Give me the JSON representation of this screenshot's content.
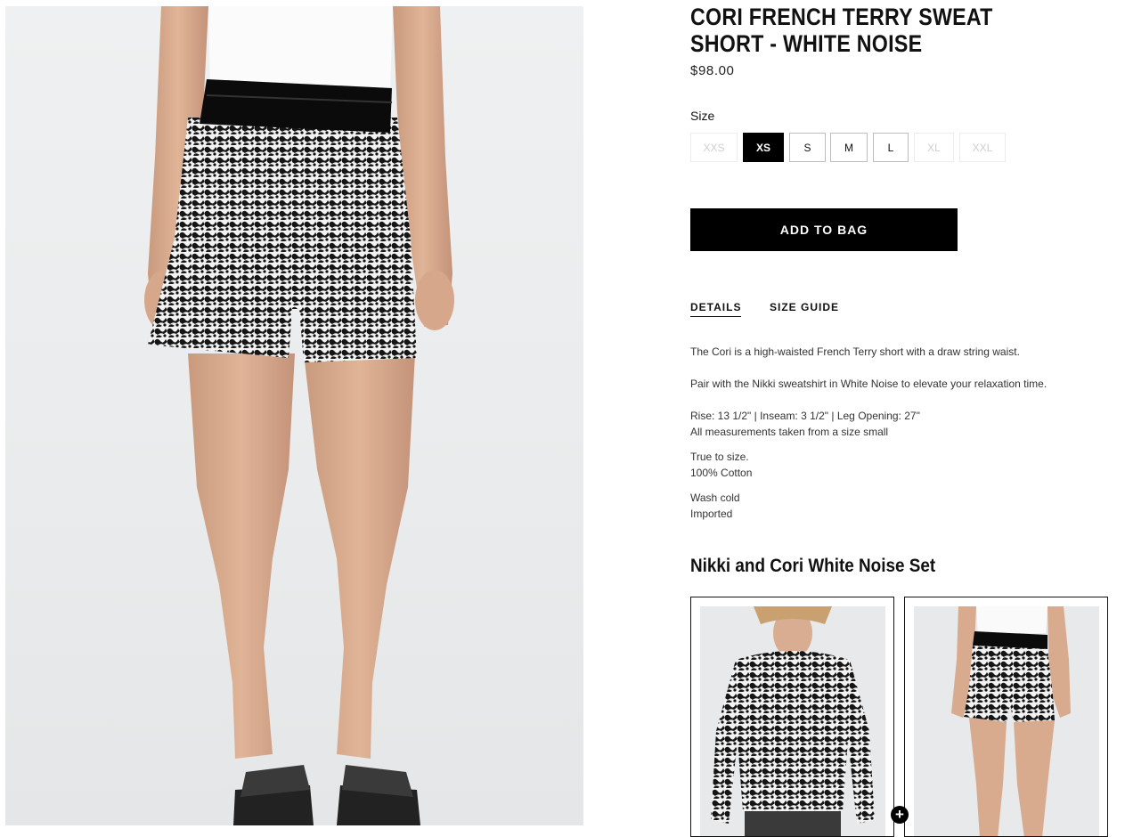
{
  "product": {
    "title": "CORI FRENCH TERRY SWEAT SHORT - WHITE NOISE",
    "price": "$98.00",
    "main_image_icon": "product-photo-shorts"
  },
  "size_selector": {
    "label": "Size",
    "options": [
      {
        "label": "XXS",
        "state": "unavailable"
      },
      {
        "label": "XS",
        "state": "selected"
      },
      {
        "label": "S",
        "state": "available"
      },
      {
        "label": "M",
        "state": "available"
      },
      {
        "label": "L",
        "state": "available"
      },
      {
        "label": "XL",
        "state": "unavailable"
      },
      {
        "label": "XXL",
        "state": "unavailable"
      }
    ]
  },
  "add_to_bag_label": "ADD TO BAG",
  "tabs": [
    {
      "label": "DETAILS",
      "active": true
    },
    {
      "label": "SIZE GUIDE",
      "active": false
    }
  ],
  "details": {
    "p1": "The Cori is a high-waisted French Terry short with a draw string waist.",
    "p2": "Pair with the Nikki sweatshirt in White Noise to elevate your relaxation time.",
    "p3_line1": "Rise: 13 1/2\" | Inseam: 3 1/2\" | Leg Opening: 27\"",
    "p3_line2": "All measurements taken from a size small",
    "p4_line1": "True to size.",
    "p4_line2": "100% Cotton",
    "p5_line1": "Wash cold",
    "p5_line2": "Imported"
  },
  "set": {
    "heading": "Nikki and Cori White Noise Set",
    "items": [
      {
        "icon": "sweatshirt-thumbnail"
      },
      {
        "icon": "shorts-thumbnail"
      }
    ],
    "add_icon": "plus-icon",
    "add_symbol": "+"
  },
  "colors": {
    "accent": "#000000",
    "page_bg": "#ffffff",
    "photo_bg": "#ebedee",
    "unavailable_text": "#cfcfcf"
  }
}
